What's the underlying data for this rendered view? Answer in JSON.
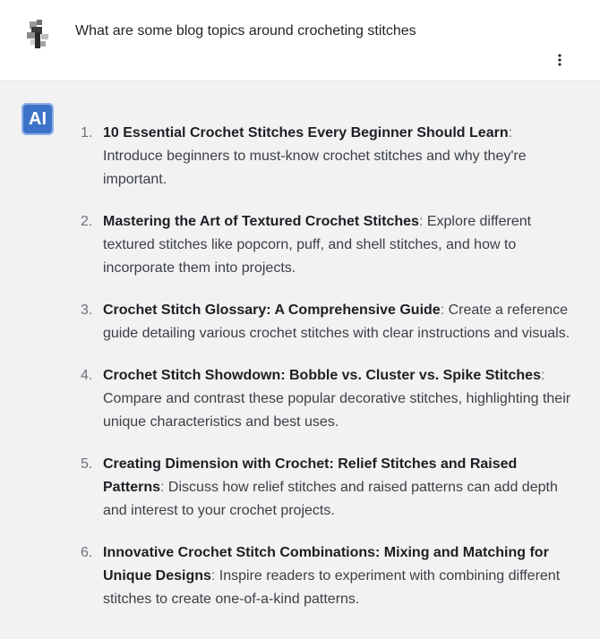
{
  "user": {
    "question": "What are some blog topics around crocheting stitches"
  },
  "ai": {
    "badge": "AI"
  },
  "items": [
    {
      "num": "1.",
      "title": "10 Essential Crochet Stitches Every Beginner Should Learn",
      "text": " Introduce beginners to must-know crochet stitches and why they're important."
    },
    {
      "num": "2.",
      "title": "Mastering the Art of Textured Crochet Stitches",
      "text": " Explore different textured stitches like popcorn, puff, and shell stitches, and how to incorporate them into projects."
    },
    {
      "num": "3.",
      "title": "Crochet Stitch Glossary: A Comprehensive Guide",
      "text": " Create a reference guide detailing various crochet stitches with clear instructions and visuals."
    },
    {
      "num": "4.",
      "title": "Crochet Stitch Showdown: Bobble vs. Cluster vs. Spike Stitches",
      "text": " Compare and contrast these popular decorative stitches, highlighting their unique characteristics and best uses."
    },
    {
      "num": "5.",
      "title": "Creating Dimension with Crochet: Relief Stitches and Raised Patterns",
      "text": " Discuss how relief stitches and raised patterns can add depth and interest to your crochet projects."
    },
    {
      "num": "6.",
      "title": "Innovative Crochet Stitch Combinations: Mixing and Matching for Unique Designs",
      "text": " Inspire readers to experiment with combining different stitches to create one-of-a-kind patterns."
    }
  ],
  "colors": {
    "ai_badge": "#3d72c9",
    "background": "#f2f2f3"
  }
}
